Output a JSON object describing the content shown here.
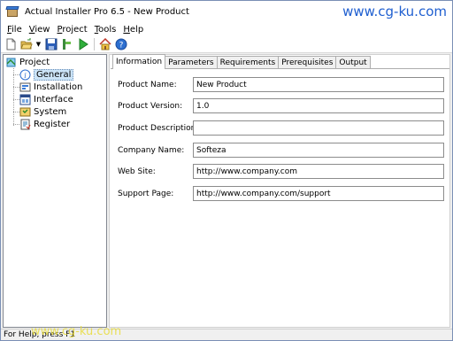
{
  "window": {
    "title": "Actual Installer Pro 6.5 - New Product",
    "watermark": "www.cg-ku.com"
  },
  "menu": {
    "items": [
      {
        "first": "F",
        "rest": "ile"
      },
      {
        "first": "V",
        "rest": "iew"
      },
      {
        "first": "P",
        "rest": "roject"
      },
      {
        "first": "T",
        "rest": "ools"
      },
      {
        "first": "H",
        "rest": "elp"
      }
    ]
  },
  "toolbar": {
    "icons": [
      "new-document-icon",
      "open-folder-icon",
      "dropdown-arrow-icon",
      "save-icon",
      "build-icon",
      "run-icon",
      "home-icon",
      "help-icon"
    ],
    "dropdown_glyph": "▼"
  },
  "tree": {
    "root": "Project",
    "items": [
      {
        "label": "General",
        "icon": "info-icon"
      },
      {
        "label": "Installation",
        "icon": "installation-icon"
      },
      {
        "label": "Interface",
        "icon": "interface-icon"
      },
      {
        "label": "System",
        "icon": "system-icon"
      },
      {
        "label": "Register",
        "icon": "register-icon"
      }
    ]
  },
  "tabs": [
    "Information",
    "Parameters",
    "Requirements",
    "Prerequisites",
    "Output"
  ],
  "form": {
    "product_name_label": "Product Name:",
    "product_name_value": "New Product",
    "product_version_label": "Product Version:",
    "product_version_value": "1.0",
    "product_description_label": "Product Description:",
    "product_description_value": "",
    "company_name_label": "Company Name:",
    "company_name_value": "Softeza",
    "web_site_label": "Web Site:",
    "web_site_value": "http://www.company.com",
    "support_page_label": "Support Page:",
    "support_page_value": "http://www.company.com/support"
  },
  "status": {
    "text": "For Help, press F1",
    "watermark": "www.cg-ku.com"
  },
  "colors": {
    "accent": "#1f5fd0",
    "selection": "#cce4f7",
    "watermark_bottom": "#e8dc3a"
  }
}
